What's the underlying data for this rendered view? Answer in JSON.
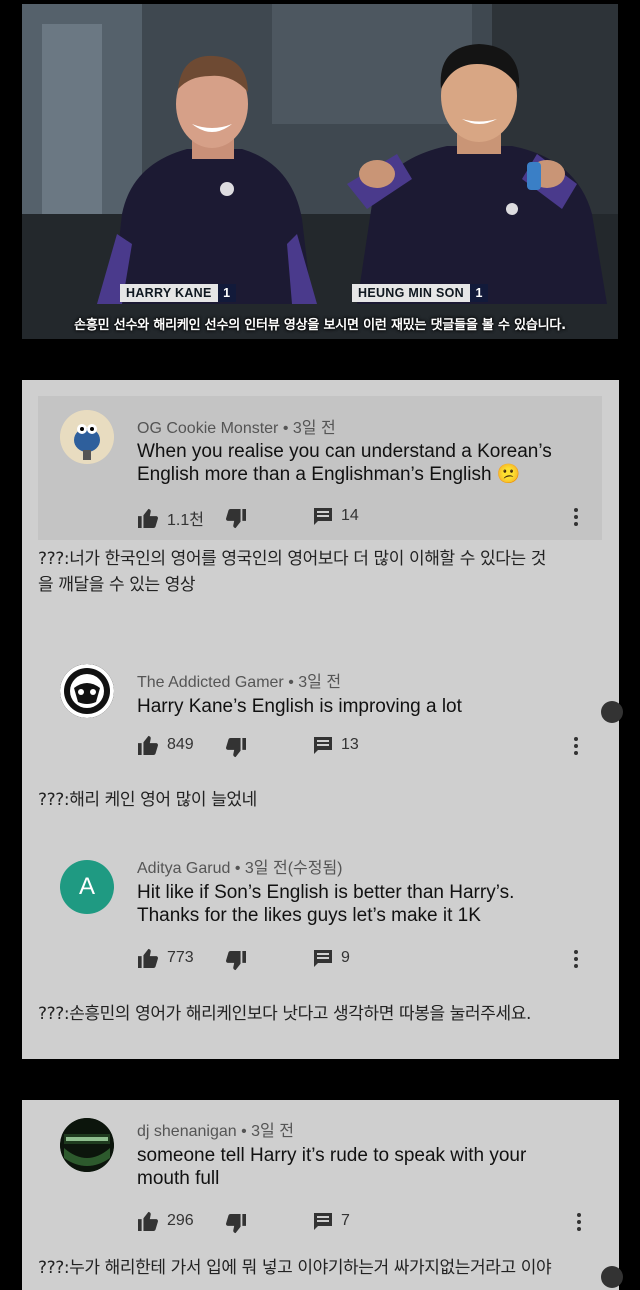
{
  "video": {
    "caption": "손흥민 선수와 해리케인 선수의 인터뷰 영상을 보시면 이런 재밌는 댓글들을 볼 수 있습니다.",
    "left_tag": {
      "name": "HARRY  KANE",
      "number": "1"
    },
    "right_tag": {
      "name": "HEUNG MIN SON",
      "number": "1"
    }
  },
  "comments": [
    {
      "author": "OG Cookie Monster",
      "time": "3일 전",
      "text_lines": [
        "When you realise you can understand a Korean’s",
        "English more than a Englishman’s English 😕"
      ],
      "likes": "1.1천",
      "replies": "14",
      "translation_lines": [
        "???:너가 한국인의 영어를 영국인의 영어보다 더 많이 이해할 수 있다는 것",
        "을 깨달을 수 있는 영상"
      ]
    },
    {
      "author": "The Addicted Gamer",
      "time": "3일 전",
      "text_lines": [
        "Harry Kane’s English is improving a lot"
      ],
      "likes": "849",
      "replies": "13",
      "translation_lines": [
        "???:해리 케인 영어 많이 늘었네"
      ]
    },
    {
      "author": "Aditya Garud",
      "time": "3일 전(수정됨)",
      "avatar_letter": "A",
      "text_lines": [
        "Hit like if Son’s English is better than Harry’s.",
        "Thanks for the likes guys let’s make it 1K"
      ],
      "likes": "773",
      "replies": "9",
      "translation_lines": [
        "???:손흥민의 영어가 해리케인보다 낫다고 생각하면 따봉을 눌러주세요."
      ]
    },
    {
      "author": "dj shenanigan",
      "time": "3일 전",
      "text_lines": [
        "someone tell Harry it’s rude to speak with your",
        "mouth full"
      ],
      "likes": "296",
      "replies": "7",
      "translation_lines": [
        "???:누가 해리한테 가서 입에 뭐 넣고 이야기하는거 싸가지없는거라고 이야"
      ]
    }
  ],
  "separator": "•",
  "colors": {
    "panel": "#cfcfcf",
    "highlight": "#c4c4c4",
    "avatar_teal": "#1f9a82",
    "jersey": "#1a1830",
    "nametag_number_bg": "#121a3a"
  }
}
